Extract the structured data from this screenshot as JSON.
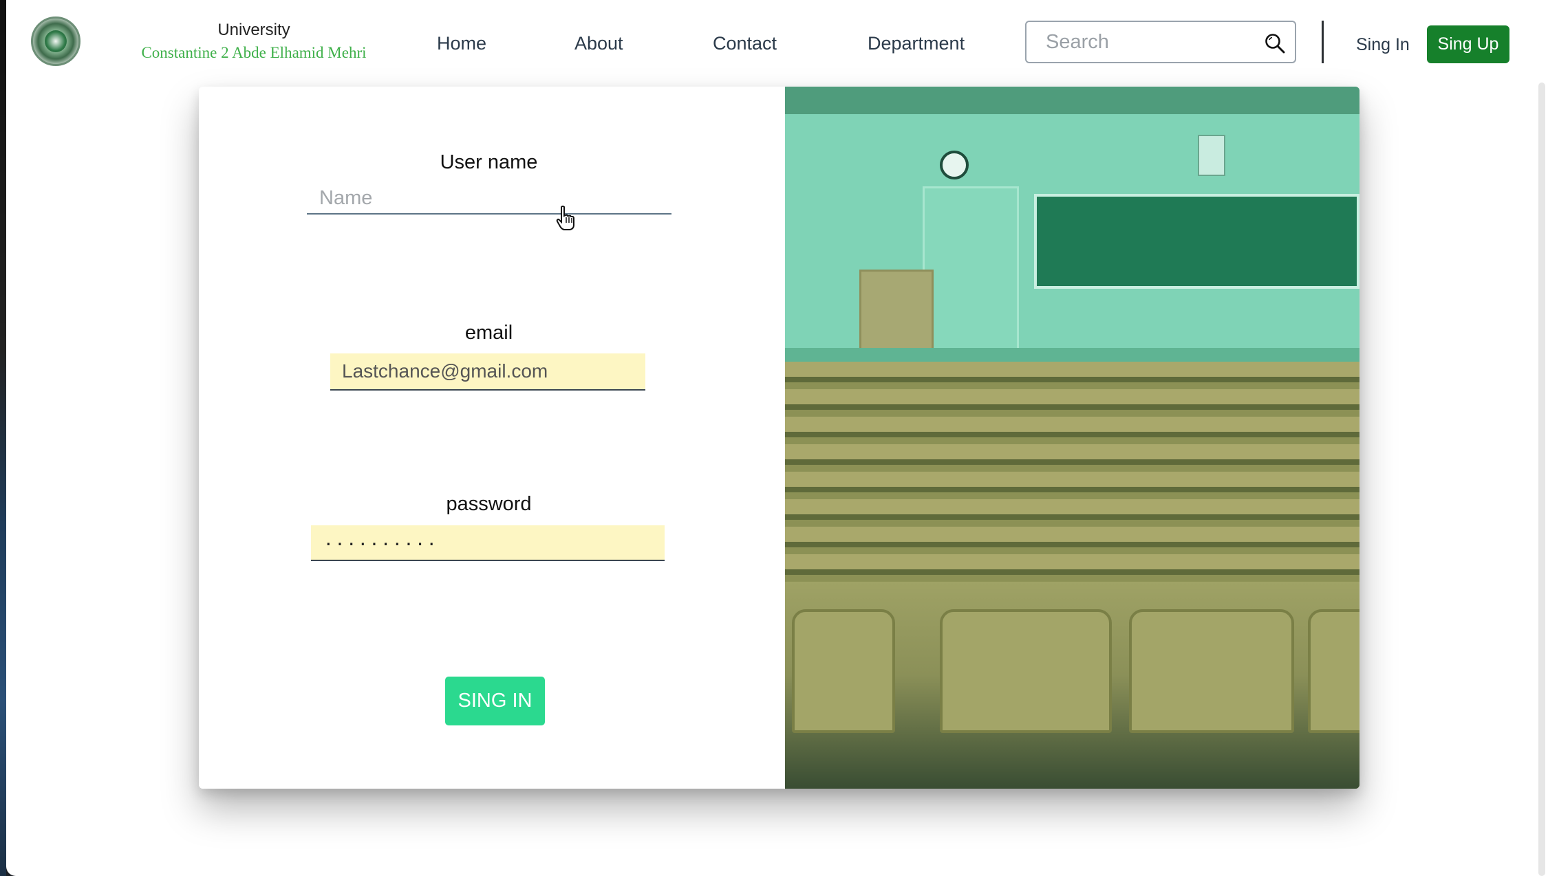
{
  "brand": {
    "line1": "University",
    "line2": "Constantine 2 Abde Elhamid Mehri"
  },
  "nav": {
    "links": [
      "Home",
      "About",
      "Contact",
      "Department"
    ],
    "search_placeholder": "Search",
    "signin": "Sing In",
    "signup": "Sing Up"
  },
  "form": {
    "username_label": "User name",
    "username_placeholder": "Name",
    "email_label": "email",
    "email_value": "Lastchance@gmail.com",
    "password_label": "password",
    "password_value": "··········",
    "submit": "SING IN"
  },
  "colors": {
    "brand_green": "#16802b",
    "submit_teal": "#2bd98f",
    "autofill_yellow": "#fdf6c3",
    "brand_subtitle": "#3fb04a"
  },
  "icons": {
    "search": "search-icon",
    "cursor": "hand-pointer-icon",
    "logo": "university-logo"
  }
}
